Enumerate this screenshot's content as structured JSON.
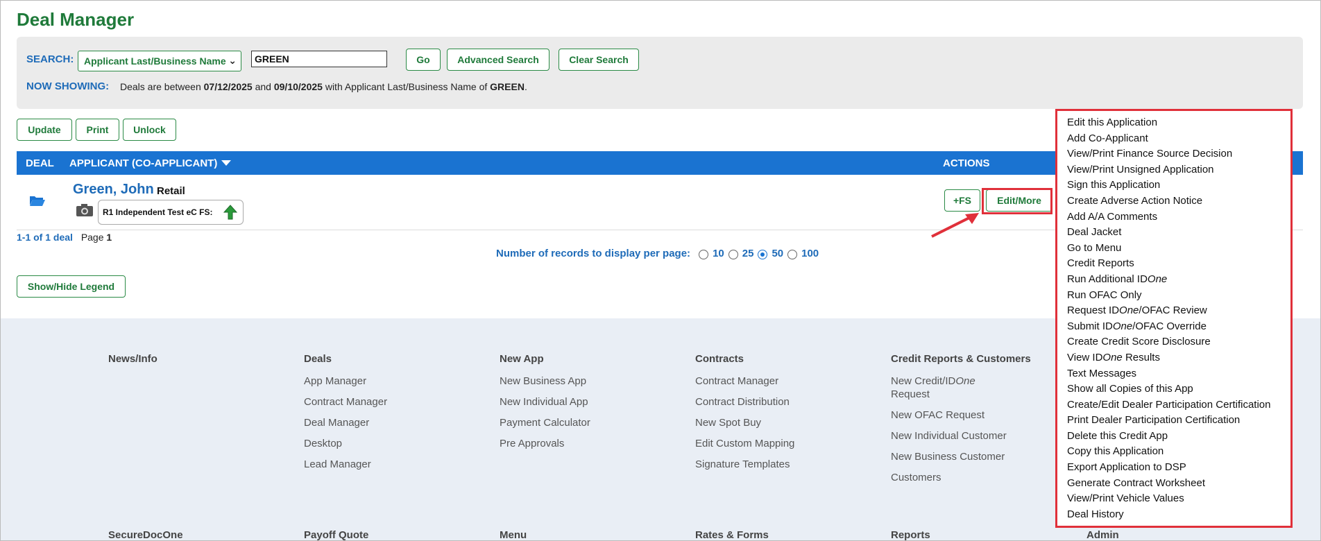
{
  "page_title": "Deal Manager",
  "search": {
    "label": "SEARCH:",
    "field_selected": "Applicant Last/Business Name",
    "value": "GREEN",
    "go": "Go",
    "advanced": "Advanced Search",
    "clear": "Clear Search"
  },
  "showing": {
    "label": "NOW SHOWING:",
    "prefix": "Deals are between ",
    "date_from": "07/12/2025",
    "mid": " and ",
    "date_to": "09/10/2025",
    "suffix": " with Applicant Last/Business Name of ",
    "name": "GREEN",
    "end": "."
  },
  "toolbar": {
    "update": "Update",
    "print": "Print",
    "unlock": "Unlock"
  },
  "table": {
    "col_deal": "DEAL",
    "col_applicant": "APPLICANT (CO-APPLICANT)",
    "col_actions": "ACTIONS",
    "row": {
      "name": "Green, John",
      "type": "Retail",
      "finance_source": "R1 Independent Test eC FS:",
      "fs_button": "+FS",
      "edit_button": "Edit/More"
    }
  },
  "pager": {
    "count": "1-1 of 1 deal",
    "page_label": "Page",
    "page_num": "1",
    "per_page_label": "Number of records to display per page:",
    "options": [
      "10",
      "25",
      "50",
      "100"
    ],
    "selected": "50"
  },
  "legend_button": "Show/Hide Legend",
  "footer": {
    "news": {
      "title": "News/Info"
    },
    "deals": {
      "title": "Deals",
      "items": [
        "App Manager",
        "Contract Manager",
        "Deal Manager",
        "Desktop",
        "Lead Manager"
      ]
    },
    "newapp": {
      "title": "New App",
      "items": [
        "New Business App",
        "New Individual App",
        "Payment Calculator",
        "Pre Approvals"
      ]
    },
    "contracts": {
      "title": "Contracts",
      "items": [
        "Contract Manager",
        "Contract Distribution",
        "New Spot Buy",
        "Edit Custom Mapping",
        "Signature Templates"
      ]
    },
    "credit": {
      "title": "Credit Reports & Customers",
      "item0a": "New Credit/ID",
      "item0b": "One",
      "item0c": "Request",
      "items": [
        "New OFAC Request",
        "New Individual Customer",
        "New Business Customer",
        "Customers"
      ]
    },
    "bottom": [
      "SecureDocOne",
      "Payoff Quote",
      "Menu",
      "Rates & Forms",
      "Reports",
      "Admin"
    ]
  },
  "menu": {
    "items": [
      "Edit this Application",
      "Add Co-Applicant",
      "View/Print Finance Source Decision",
      "View/Print Unsigned Application",
      "Sign this Application",
      "Create Adverse Action Notice",
      "Add A/A Comments",
      "Deal Jacket",
      "Go to Menu",
      "Credit Reports"
    ],
    "idone_a": "Run Additional ID",
    "idone_b": "One",
    "ofac_only": "Run OFAC Only",
    "req_a": "Request ID",
    "req_b": "One",
    "req_c": "/OFAC Review",
    "sub_a": "Submit ID",
    "sub_b": "One",
    "sub_c": "/OFAC Override",
    "credit_score": "Create Credit Score Disclosure",
    "view_a": "View ID",
    "view_b": "One",
    "view_c": " Results",
    "items2": [
      "Text Messages",
      "Show all Copies of this App",
      "Create/Edit Dealer Participation Certification",
      "Print Dealer Participation Certification",
      "Delete this Credit App",
      "Copy this Application",
      "Export Application to DSP",
      "Generate Contract Worksheet",
      "View/Print Vehicle Values",
      "Deal History"
    ]
  }
}
